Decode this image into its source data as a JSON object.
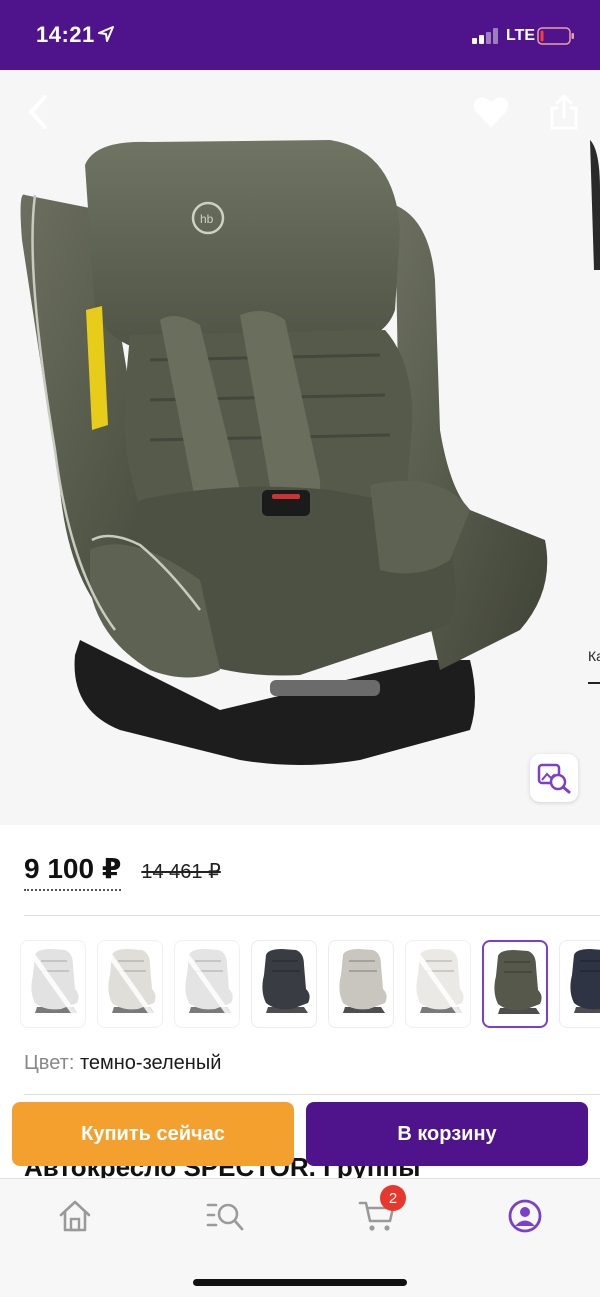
{
  "status_bar": {
    "time": "14:21",
    "network": "LTE",
    "background_color": "#4f148c"
  },
  "hero": {
    "back_icon": "chevron-left-icon",
    "favorite_icon": "heart-icon",
    "share_icon": "share-icon",
    "image_search_icon": "image-search-icon",
    "next_image_peek_text": "Ка"
  },
  "price": {
    "current": "9 100 ₽",
    "old": "14 461 ₽"
  },
  "variants": [
    {
      "color": "#d9d9d9",
      "available": false
    },
    {
      "color": "#d6d3cb",
      "available": false
    },
    {
      "color": "#dcdcdc",
      "available": false
    },
    {
      "color": "#3a3c44",
      "available": true
    },
    {
      "color": "#c9c6bf",
      "available": true
    },
    {
      "color": "#e4e2dd",
      "available": false
    },
    {
      "color": "#55584b",
      "available": true,
      "selected": true
    },
    {
      "color": "#2f3444",
      "available": true
    }
  ],
  "color": {
    "label": "Цвет:",
    "value": "темно-зеленый"
  },
  "actions": {
    "buy_now": "Купить сейчас",
    "add_to_cart": "В корзину",
    "buy_color": "#f4a02f",
    "cart_color": "#4f148c"
  },
  "product_title_peek": "Автокресло SPECTOR. Группы",
  "tabbar": {
    "items": [
      {
        "icon": "home-icon",
        "active": false
      },
      {
        "icon": "catalog-search-icon",
        "active": false
      },
      {
        "icon": "cart-icon",
        "active": false,
        "badge": "2"
      },
      {
        "icon": "profile-icon",
        "active": true
      }
    ],
    "active_color": "#7b3fc9"
  }
}
